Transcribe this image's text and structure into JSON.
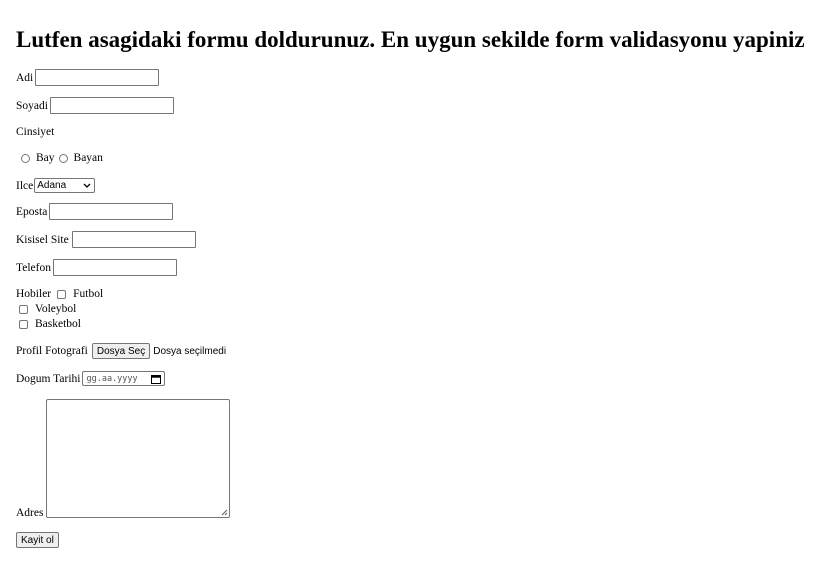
{
  "heading": "Lutfen asagidaki formu doldurunuz. En uygun sekilde form validasyonu yapiniz",
  "fields": {
    "adi": {
      "label": "Adi",
      "value": ""
    },
    "soyadi": {
      "label": "Soyadi",
      "value": ""
    },
    "cinsiyet": {
      "label": "Cinsiyet",
      "options": [
        "Bay",
        "Bayan"
      ]
    },
    "ilce": {
      "label": "Ilce",
      "selected": "Adana"
    },
    "eposta": {
      "label": "Eposta",
      "value": ""
    },
    "site": {
      "label": "Kisisel Site",
      "value": ""
    },
    "telefon": {
      "label": "Telefon",
      "value": ""
    },
    "hobiler": {
      "label": "Hobiler",
      "options": [
        "Futbol",
        "Voleybol",
        "Basketbol"
      ]
    },
    "foto": {
      "label": "Profil Fotografi",
      "button": "Dosya Seç",
      "status": "Dosya seçilmedi"
    },
    "dogum": {
      "label": "Dogum Tarihi",
      "placeholder": "gg.aa.yyyy"
    },
    "adres": {
      "label": "Adres",
      "value": ""
    }
  },
  "submit_label": "Kayit ol",
  "icons": {
    "radio": "radio-circle",
    "checkbox": "checkbox-square",
    "dropdown": "chevron-down-icon",
    "calendar": "calendar-icon",
    "resize": "resize-grip-icon"
  }
}
